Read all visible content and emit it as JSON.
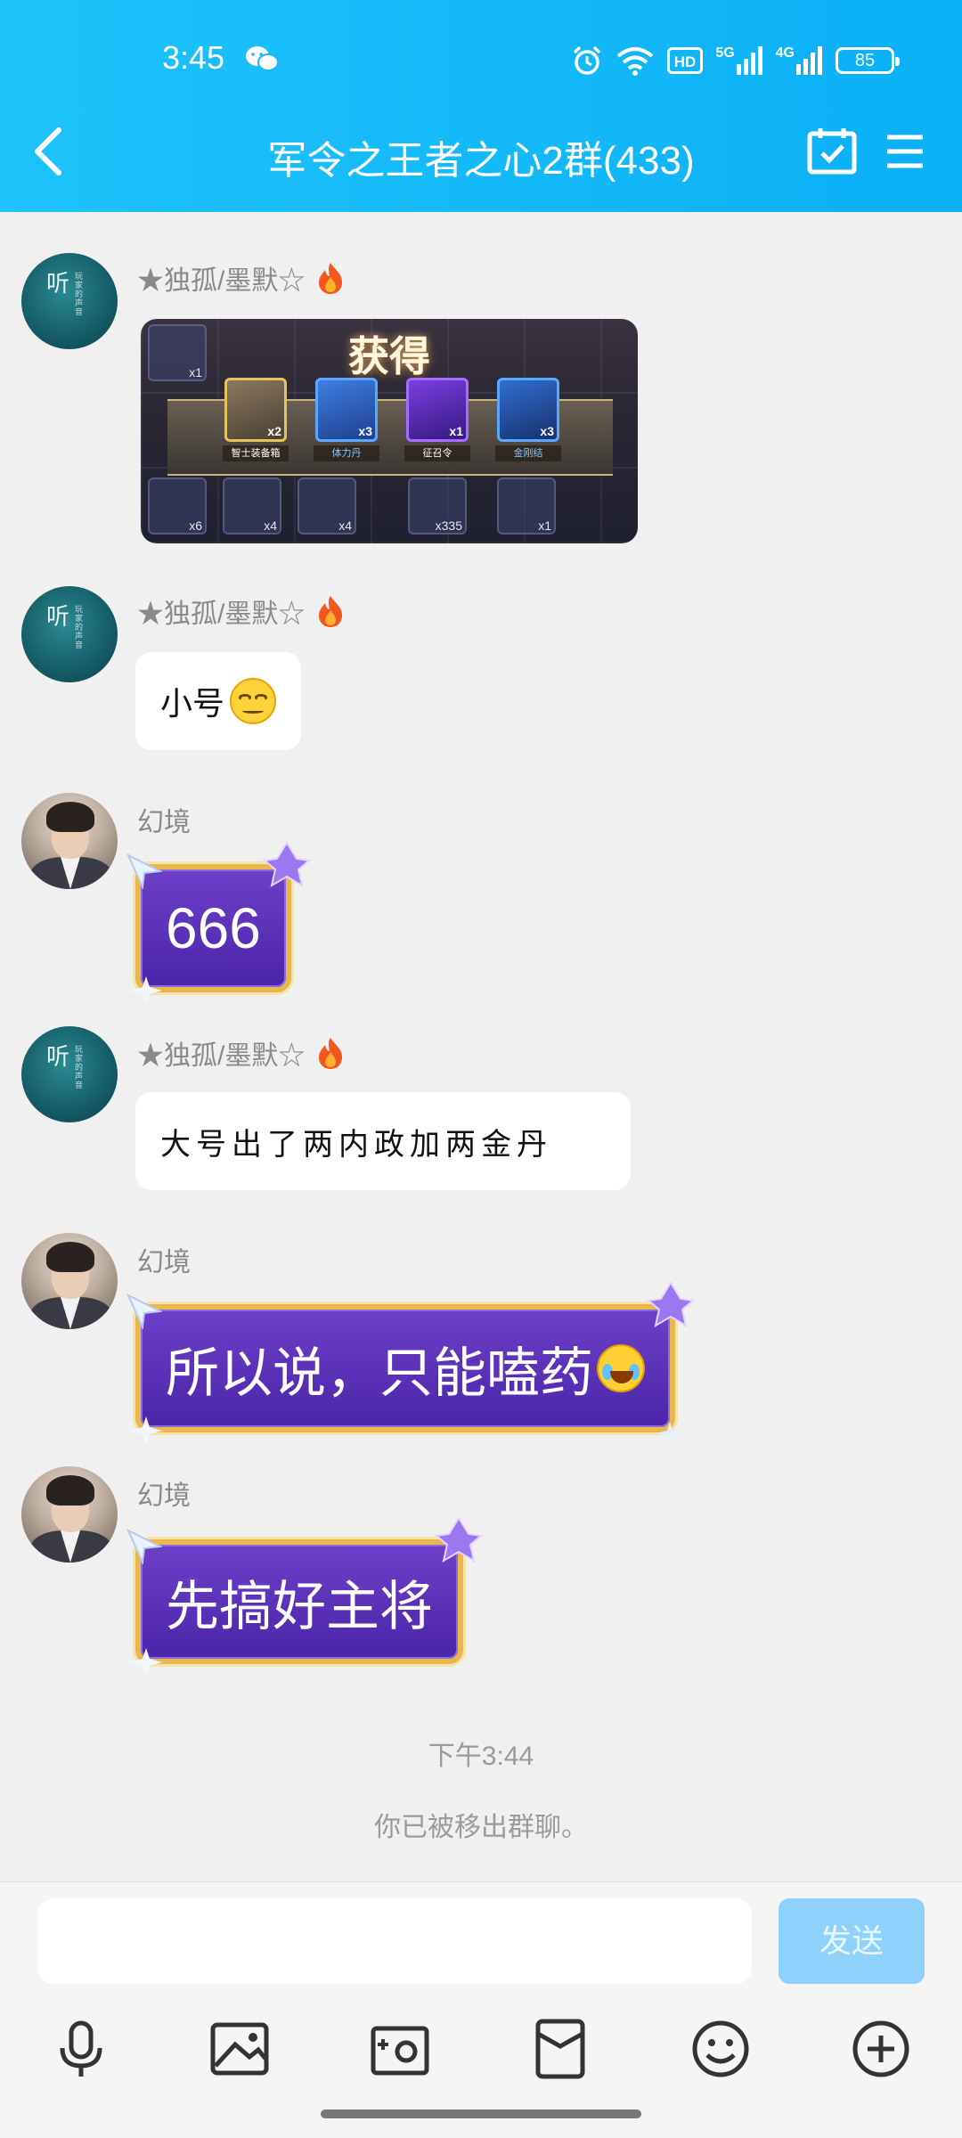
{
  "status_bar": {
    "time": "3:45",
    "network_1": "5G",
    "network_2": "4G",
    "battery": "85",
    "icons": [
      "wechat-icon",
      "alarm-icon",
      "wifi-icon",
      "hd-icon",
      "signal-icon",
      "battery-icon"
    ]
  },
  "header": {
    "title": "军令之王者之心2群(433)",
    "colors": {
      "header_start": "#1ec3fb",
      "header_end": "#0ab0f5"
    }
  },
  "messages": [
    {
      "sender": "★独孤/墨默☆",
      "avatar_text": "听",
      "avatar_subtext": "玩家的声音",
      "type": "image",
      "image": {
        "title": "获得",
        "rewards": [
          {
            "qty": "x2",
            "label": "智士装备箱"
          },
          {
            "qty": "x3",
            "label": "体力丹"
          },
          {
            "qty": "x1",
            "label": "征召令"
          },
          {
            "qty": "x3",
            "label": "金刚结"
          }
        ],
        "inventory_qty": [
          "x1",
          "x6",
          "x4",
          "x4",
          "x335",
          "x1"
        ]
      }
    },
    {
      "sender": "★独孤/墨默☆",
      "avatar_text": "听",
      "avatar_subtext": "玩家的声音",
      "type": "text",
      "text": "小号"
    },
    {
      "sender": "幻境",
      "type": "styled",
      "text": "666"
    },
    {
      "sender": "★独孤/墨默☆",
      "avatar_text": "听",
      "avatar_subtext": "玩家的声音",
      "type": "text",
      "text": "大号出了两内政加两金丹"
    },
    {
      "sender": "幻境",
      "type": "styled",
      "text": "所以说，只能嗑药"
    },
    {
      "sender": "幻境",
      "type": "styled",
      "text": "先搞好主将"
    }
  ],
  "system": {
    "time": "下午3:44",
    "notice": "你已被移出群聊。"
  },
  "input": {
    "placeholder": "",
    "send_label": "发送",
    "colors": {
      "send_bg": "#8ed2fb"
    },
    "tools": [
      "microphone-icon",
      "image-icon",
      "camera-icon",
      "red-packet-icon",
      "emoji-icon",
      "plus-icon"
    ]
  }
}
